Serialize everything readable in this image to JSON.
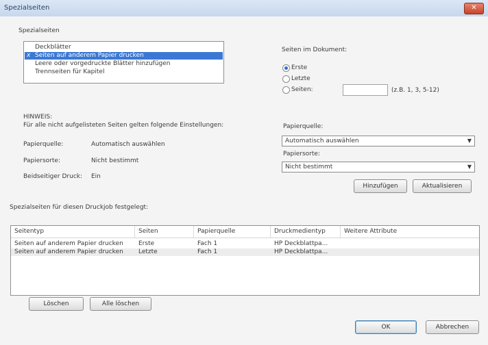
{
  "window": {
    "title": "Spezialseiten",
    "close_symbol": "✕"
  },
  "group_label": "Spezialseiten",
  "pages_list": {
    "items": [
      {
        "label": "Deckblätter",
        "checked": false,
        "selected": false
      },
      {
        "label": "Seiten auf anderem Papier drucken",
        "checked": true,
        "selected": true,
        "check_mark": "x"
      },
      {
        "label": "Leere oder vorgedruckte Blätter hinzufügen",
        "checked": false,
        "selected": false
      },
      {
        "label": "Trennseiten für Kapitel",
        "checked": false,
        "selected": false
      }
    ]
  },
  "pages_in_document": {
    "label": "Seiten im Dokument:",
    "options": [
      {
        "label": "Erste",
        "selected": true
      },
      {
        "label": "Letzte",
        "selected": false
      },
      {
        "label": "Seiten:",
        "selected": false
      }
    ],
    "pages_value": "",
    "pages_hint": "(z.B. 1, 3, 5-12)"
  },
  "note": {
    "heading": "HINWEIS:",
    "text": "Für alle nicht aufgelisteten Seiten gelten folgende Einstellungen:",
    "rows": [
      {
        "label": "Papierquelle:",
        "value": "Automatisch auswählen"
      },
      {
        "label": "Papiersorte:",
        "value": "Nicht bestimmt"
      },
      {
        "label": "Beidseitiger Druck:",
        "value": "Ein"
      }
    ]
  },
  "paper_source": {
    "label": "Papierquelle:",
    "value": "Automatisch auswählen"
  },
  "paper_type": {
    "label": "Papiersorte:",
    "value": "Nicht bestimmt"
  },
  "buttons": {
    "add": "Hinzufügen",
    "update": "Aktualisieren",
    "delete": "Löschen",
    "delete_all": "Alle löschen",
    "ok": "OK",
    "cancel": "Abbrechen"
  },
  "job_table": {
    "caption": "Spezialseiten für diesen Druckjob festgelegt:",
    "columns": [
      "Seitentyp",
      "Seiten",
      "Papierquelle",
      "Druckmedientyp",
      "Weitere Attribute"
    ],
    "rows": [
      [
        "Seiten auf anderem Papier drucken",
        "Erste",
        "Fach 1",
        "HP Deckblattpa...",
        ""
      ],
      [
        "Seiten auf anderem Papier drucken",
        "Letzte",
        "Fach 1",
        "HP Deckblattpa...",
        ""
      ]
    ]
  },
  "colors": {
    "selection": "#3a78d4",
    "close_button": "#c7442a"
  }
}
